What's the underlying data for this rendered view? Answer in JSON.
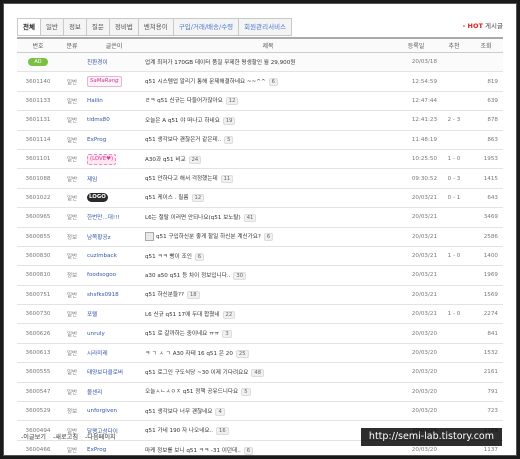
{
  "tabs": [
    "전체",
    "일반",
    "정보",
    "질문",
    "정비법",
    "벤쳐용이",
    "구입/거래/배송/수령",
    "회원관리서비스"
  ],
  "hot": {
    "mark": "- HOT",
    "label": "게시글"
  },
  "columns": [
    "번호",
    "분류",
    "글쓴이",
    "제목",
    "등록일",
    "추천",
    "조회"
  ],
  "notice": {
    "badge": "AD",
    "author": "친환경이",
    "title": "업계 최저가 170GB 데이터 품질 무제한 평생할인 월 29,900원",
    "date": "20/03/18"
  },
  "rows": [
    {
      "no": "3601140",
      "cat": "일반",
      "author": "SaMaRang",
      "author_style": "magic",
      "title": "q51 시스템업 알리기 통해 문제해결하네요 ~~^^",
      "comments": "6",
      "date": "12:54:59",
      "rec": "",
      "views": "819"
    },
    {
      "no": "3601133",
      "cat": "일반",
      "author": "Hallin",
      "author_style": "",
      "title": "ㄹㅋ q51 신규는 다들어가잖아요",
      "comments": "12",
      "date": "12:47:44",
      "rec": "",
      "views": "639"
    },
    {
      "no": "3601131",
      "cat": "일반",
      "author": "tidms80",
      "author_style": "",
      "title": "오늘은 A q51 야 떠나고 하네요",
      "comments": "19",
      "date": "12:41:23",
      "rec": "2 - 3",
      "views": "878"
    },
    {
      "no": "3601114",
      "cat": "일반",
      "author": "ExProg",
      "author_style": "",
      "title": "q51 생각보다 괜찮은거 같은데..",
      "comments": "5",
      "date": "11:48:19",
      "rec": "",
      "views": "863"
    },
    {
      "no": "3601101",
      "cat": "일반",
      "author": "(LOVE♥)",
      "author_style": "cute",
      "title": "A30과 q51 비교",
      "comments": "24",
      "date": "10:25:50",
      "rec": "1 - 0",
      "views": "1953"
    },
    {
      "no": "3601088",
      "cat": "일반",
      "author": "제임",
      "author_style": "",
      "title": "q51 안하다고 해서 걱정했는데",
      "comments": "11",
      "date": "09:30:52",
      "rec": "0 - 3",
      "views": "1415"
    },
    {
      "no": "3601022",
      "cat": "일반",
      "author": "LOGO",
      "author_style": "logo",
      "title": "q51 케이스 . 필름",
      "comments": "12",
      "date": "20/03/21",
      "rec": "0 - 1",
      "views": "643"
    },
    {
      "no": "3600965",
      "cat": "일반",
      "author": "한번만...대!!!",
      "author_style": "",
      "title": "L6는 절탈 이러면 안되나요(q51 보노탈)",
      "comments": "41",
      "date": "20/03/21",
      "rec": "",
      "views": "3469"
    },
    {
      "no": "3600855",
      "cat": "정보",
      "author": "남쪽황공z",
      "author_style": "icon",
      "title": "q51 구입하신분 좋게 할일 하신분 계신가요?",
      "comments": "6",
      "date": "20/03/21",
      "rec": "",
      "views": "2586"
    },
    {
      "no": "3600830",
      "cat": "일반",
      "author": "cuzlmback",
      "author_style": "",
      "title": "q51 ㅋㅋ 빵이 조인",
      "comments": "6",
      "date": "20/03/21",
      "rec": "1 - 0",
      "views": "1400"
    },
    {
      "no": "3600810",
      "cat": "정보",
      "author": "foodsogoo",
      "author_style": "",
      "title": "a30 a50 q51 등 차이 정보입니다..",
      "comments": "30",
      "date": "20/03/21",
      "rec": "",
      "views": "1969"
    },
    {
      "no": "3600751",
      "cat": "일반",
      "author": "shsfks0918",
      "author_style": "",
      "title": "q51 하신분들??",
      "comments": "18",
      "date": "20/03/21",
      "rec": "",
      "views": "1569"
    },
    {
      "no": "3600730",
      "cat": "일반",
      "author": "포텔",
      "author_style": "",
      "title": "L6 신규 q51 17에 두대 합쳤네",
      "comments": "22",
      "date": "20/03/21",
      "rec": "1 - 0",
      "views": "2274"
    },
    {
      "no": "3600626",
      "cat": "일반",
      "author": "unruly",
      "author_style": "",
      "title": "q51 로 갈까하는 중이네요 ㅠㅠ",
      "comments": "3",
      "date": "20/03/20",
      "rec": "",
      "views": "841"
    },
    {
      "no": "3600613",
      "cat": "일반",
      "author": "시라미레",
      "author_style": "",
      "title": "ㅋ ㄱ ㅅ ㄱ A30 자테 16 q51 은 20",
      "comments": "25",
      "date": "20/03/20",
      "rec": "",
      "views": "1532"
    },
    {
      "no": "3600555",
      "cat": "일반",
      "author": "태양보다클로버",
      "author_style": "",
      "title": "q51 로그인 구도식당 ~30 이제 기다려요요",
      "comments": "48",
      "date": "20/03/20",
      "rec": "",
      "views": "2161"
    },
    {
      "no": "3600547",
      "cat": "일반",
      "author": "볼센리",
      "author_style": "",
      "title": "오늘ㅅㄴㅅㅇㅈ q51 정책 공유드니다요",
      "comments": "5",
      "date": "20/03/20",
      "rec": "",
      "views": "791"
    },
    {
      "no": "3600529",
      "cat": "정보",
      "author": "unforgiven",
      "author_style": "",
      "title": "q51 생각보다 너무 괜찮네요",
      "comments": "4",
      "date": "20/03/20",
      "rec": "",
      "views": "723"
    },
    {
      "no": "3600494",
      "cat": "일반",
      "author": "달팽고성다이",
      "author_style": "",
      "title": "q51 가네 190 자 나오네요..",
      "comments": "16",
      "date": "20/03/20",
      "rec": "",
      "views": "1169"
    },
    {
      "no": "3600466",
      "cat": "일반",
      "author": "ExProg",
      "author_style": "",
      "title": "마케 정보를 보니 q51 ㅋㅋ -31 이던데..",
      "comments": "6",
      "date": "20/03/20",
      "rec": "",
      "views": "1137"
    }
  ],
  "bottom_links": [
    "-이글보기",
    "-새로고침",
    "-다음페이지"
  ],
  "watermark": "http://semi-lab.tistory.com"
}
